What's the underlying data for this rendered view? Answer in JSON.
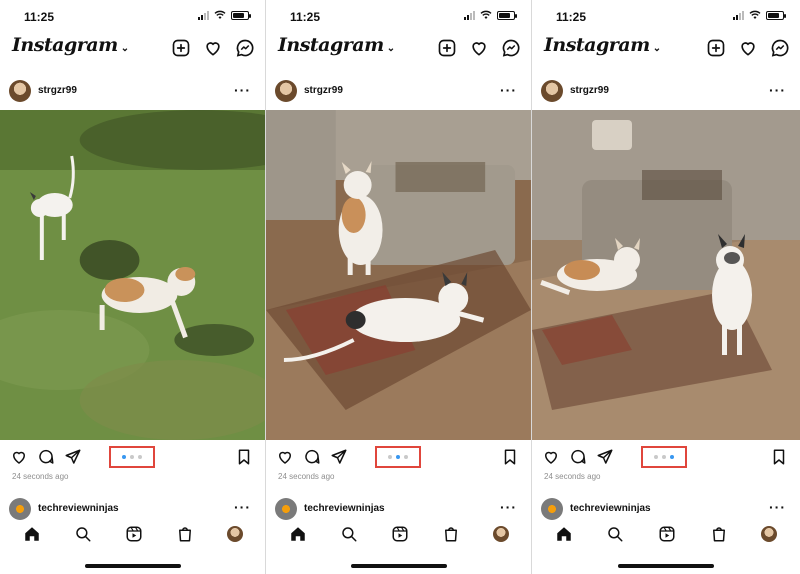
{
  "status_bar": {
    "time": "11:25"
  },
  "app": {
    "logo": "Instagram"
  },
  "screens": [
    {
      "post": {
        "username": "strgzr99",
        "time_ago": "24 seconds ago",
        "carousel_total": 3,
        "carousel_active": 1
      },
      "next_post": {
        "username": "techreviewninjas"
      }
    },
    {
      "post": {
        "username": "strgzr99",
        "time_ago": "24 seconds ago",
        "carousel_total": 3,
        "carousel_active": 2
      },
      "next_post": {
        "username": "techreviewninjas"
      }
    },
    {
      "post": {
        "username": "strgzr99",
        "time_ago": "24 seconds ago",
        "carousel_total": 3,
        "carousel_active": 3
      },
      "next_post": {
        "username": "techreviewninjas"
      }
    }
  ],
  "colors": {
    "highlight_box": "#e0463c",
    "active_dot": "#3897f0",
    "inactive_dot": "#c9c9c9"
  },
  "icons": [
    "new-post-icon",
    "heart-icon",
    "messenger-icon",
    "more-icon",
    "like-icon",
    "comment-icon",
    "share-icon",
    "bookmark-icon",
    "home-icon",
    "search-icon",
    "reels-icon",
    "shop-icon",
    "profile-avatar"
  ]
}
